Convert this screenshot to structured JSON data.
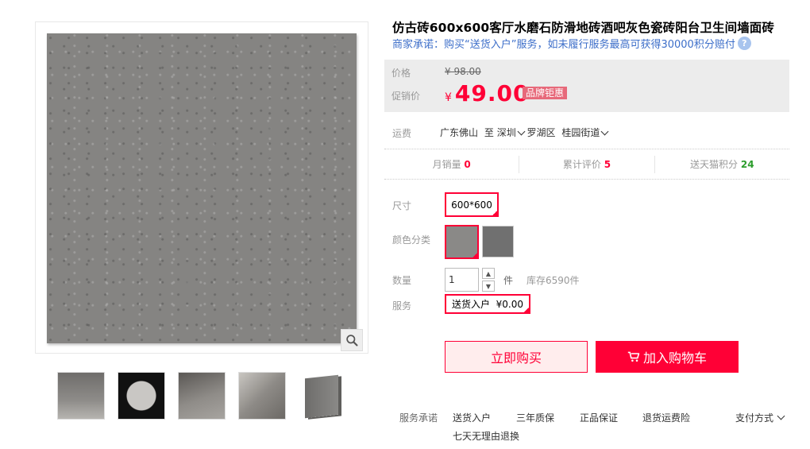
{
  "product": {
    "title": "仿古砖600x600客厅水磨石防滑地砖酒吧灰色瓷砖阳台卫生间墙面砖",
    "promise": "商家承诺：购买“送货入户”服务，如未履行服务最高可获得30000积分赔付"
  },
  "price": {
    "price_label": "价格",
    "original": "¥ 98.00",
    "promo_label": "促销价",
    "currency": "¥",
    "promo": "49.00",
    "badge": "品牌钜惠"
  },
  "shipping": {
    "label": "运费",
    "from": "广东佛山",
    "to_word": "至",
    "city": "深圳",
    "district": "罗湖区",
    "street": "桂园街道"
  },
  "stats": [
    {
      "label": "月销量",
      "value": "0"
    },
    {
      "label": "累计评价",
      "value": "5"
    },
    {
      "label": "送天猫积分",
      "value": "24"
    }
  ],
  "sku": {
    "size_label": "尺寸",
    "size_value": "600*600",
    "color_label": "颜色分类",
    "qty_label": "数量",
    "qty_value": "1",
    "unit": "件",
    "stock": "库存6590件",
    "service_label": "服务",
    "service_value": "送货入户  ¥0.00"
  },
  "actions": {
    "buy_now": "立即购买",
    "add_cart": "加入购物车"
  },
  "services": {
    "label": "服务承诺",
    "items": [
      "送货入户",
      "三年质保",
      "正品保证",
      "退货运费险",
      "七天无理由退换"
    ],
    "payment": "支付方式"
  },
  "colors": {
    "accent": "#ff0036",
    "link": "#3c6ec9",
    "tile_gray": "#858482"
  }
}
